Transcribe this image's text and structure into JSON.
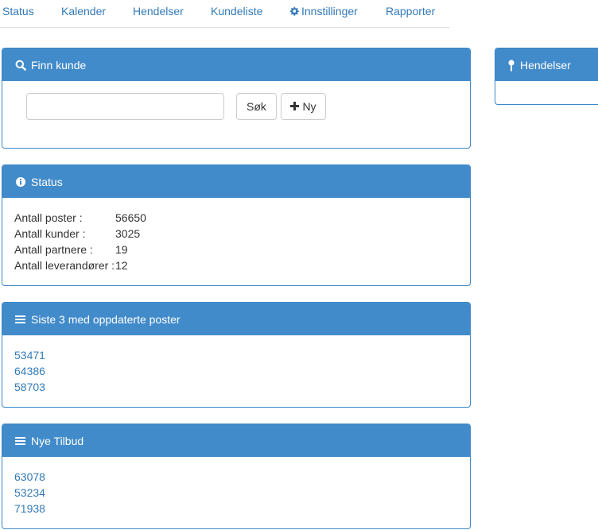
{
  "nav": {
    "items": [
      {
        "label": "Status"
      },
      {
        "label": "Kalender"
      },
      {
        "label": "Hendelser"
      },
      {
        "label": "Kundeliste"
      },
      {
        "label": "Innstillinger",
        "icon": "gear-icon"
      },
      {
        "label": "Rapporter"
      }
    ]
  },
  "finn_kunde": {
    "title": "Finn kunde",
    "icon": "search-icon",
    "search_value": "",
    "search_button": "Søk",
    "new_button": "Ny",
    "new_icon": "plus-icon"
  },
  "status": {
    "title": "Status",
    "icon": "info-icon",
    "rows": [
      {
        "label": "Antall poster :",
        "value": "56650"
      },
      {
        "label": "Antall kunder :",
        "value": "3025"
      },
      {
        "label": "Antall partnere :",
        "value": "19"
      },
      {
        "label": "Antall leverandører :",
        "value": "12"
      }
    ]
  },
  "siste": {
    "title": "Siste 3 med oppdaterte poster",
    "icon": "list-icon",
    "items": [
      "53471",
      "64386",
      "58703"
    ]
  },
  "tilbud": {
    "title": "Nye Tilbud",
    "icon": "list-icon",
    "items": [
      "63078",
      "53234",
      "71938"
    ]
  },
  "hendelser": {
    "title": "Hendelser",
    "icon": "pushpin-icon"
  },
  "colors": {
    "panel_heading": "#428bca",
    "link": "#337ab7",
    "border": "#3a87c8"
  }
}
